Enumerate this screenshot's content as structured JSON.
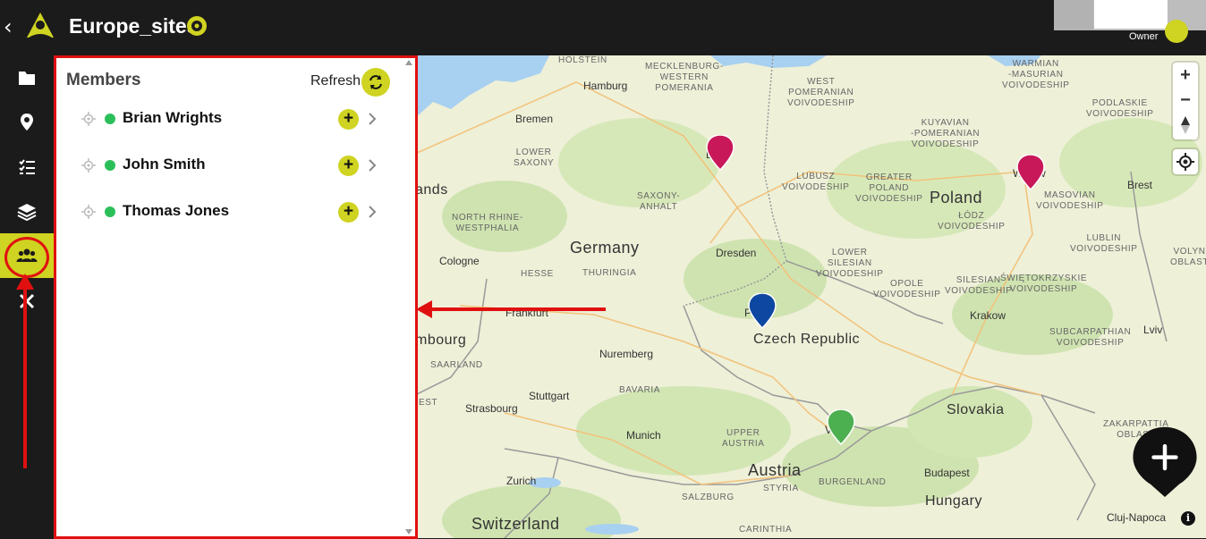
{
  "header": {
    "back_symbol": "‹",
    "title": "Europe_sites",
    "owner_label": "Owner"
  },
  "panel": {
    "title": "Members",
    "refresh_label": "Refresh",
    "members": [
      {
        "name": "Brian Wrights"
      },
      {
        "name": "John Smith"
      },
      {
        "name": "Thomas Jones"
      }
    ],
    "add_symbol": "+"
  },
  "map": {
    "countries": {
      "germany": "Germany",
      "poland": "Poland",
      "czech": "Czech Republic",
      "austria": "Austria",
      "switzerland": "Switzerland",
      "slovakia": "Slovakia",
      "hungary": "Hungary",
      "netherlands_partial": "ands",
      "luxembourg_partial": "mbourg"
    },
    "cities": {
      "hamburg": "Hamburg",
      "bremen": "Bremen",
      "cologne": "Cologne",
      "frankfurt": "Frankfurt",
      "nuremberg": "Nuremberg",
      "stuttgart": "Stuttgart",
      "strasbourg": "Strasbourg",
      "munich": "Munich",
      "zurich": "Zurich",
      "dresden": "Dresden",
      "krakow": "Krakow",
      "budapest": "Budapest",
      "brest": "Brest",
      "lviv": "Lviv",
      "cluj": "Cluj-Napoca",
      "berlin_partial": "L    n",
      "warsaw_partial": "W     w",
      "prague_partial": "P    e",
      "vienna_partial": "V    a"
    },
    "regions": {
      "holstein": "HOLSTEIN",
      "mecklenburg": "MECKLENBURG-\nWESTERN\nPOMERANIA",
      "west_pomeranian": "WEST\nPOMERANIAN\nVOIVODESHIP",
      "warmian": "WARMIAN\n-MASURIAN\nVOIVODESHIP",
      "kuyavian": "KUYAVIAN\n-POMERANIAN\nVOIVODESHIP",
      "podlaskie": "PODLASKIE\nVOIVODESHIP",
      "lower_saxony": "LOWER\nSAXONY",
      "lubusz": "LUBUSZ\nVOIVODESHIP",
      "greater_poland": "GREATER\nPOLAND\nVOIVODESHIP",
      "masovian": "MASOVIAN\nVOIVODESHIP",
      "saxony_anhalt": "SAXONY-\nANHALT",
      "nrw": "NORTH RHINE-\nWESTPHALIA",
      "lodz": "ŁÓDZ\nVOIVODESHIP",
      "lublin": "LUBLIN\nVOIVODESHIP",
      "hesse": "HESSE",
      "thuringia": "THURINGIA",
      "lower_silesian": "LOWER\nSILESIAN\nVOIVODESHIP",
      "opole": "OPOLE\nVOIVODESHIP",
      "silesian": "SILESIAN\nVOIVODESHIP",
      "swietokrzyskie": "ŚWIĘTOKRZYSKIE\nVOIVODESHIP",
      "volyn": "VOLYN\nOBLAST",
      "subcarpathian": "SUBCARPATHIAN\nVOIVODESHIP",
      "saarland": "SAARLAND",
      "bavaria": "BAVARIA",
      "zakarpattia": "ZAKARPATTIA\nOBLAST",
      "upper_austria": "UPPER\nAUSTRIA",
      "burgenland": "BURGENLAND",
      "styria": "STYRIA",
      "salzburg": "SALZBURG",
      "carinthia": "CARINTHIA",
      "est": "EST"
    },
    "zoom_in": "+",
    "zoom_out": "−",
    "info_symbol": "i"
  },
  "colors": {
    "accent": "#cfd321",
    "highlight": "#e01010",
    "online": "#2bbf5a",
    "pin_magenta": "#c8185a",
    "pin_blue": "#0d47a1",
    "pin_green": "#4caf50"
  }
}
